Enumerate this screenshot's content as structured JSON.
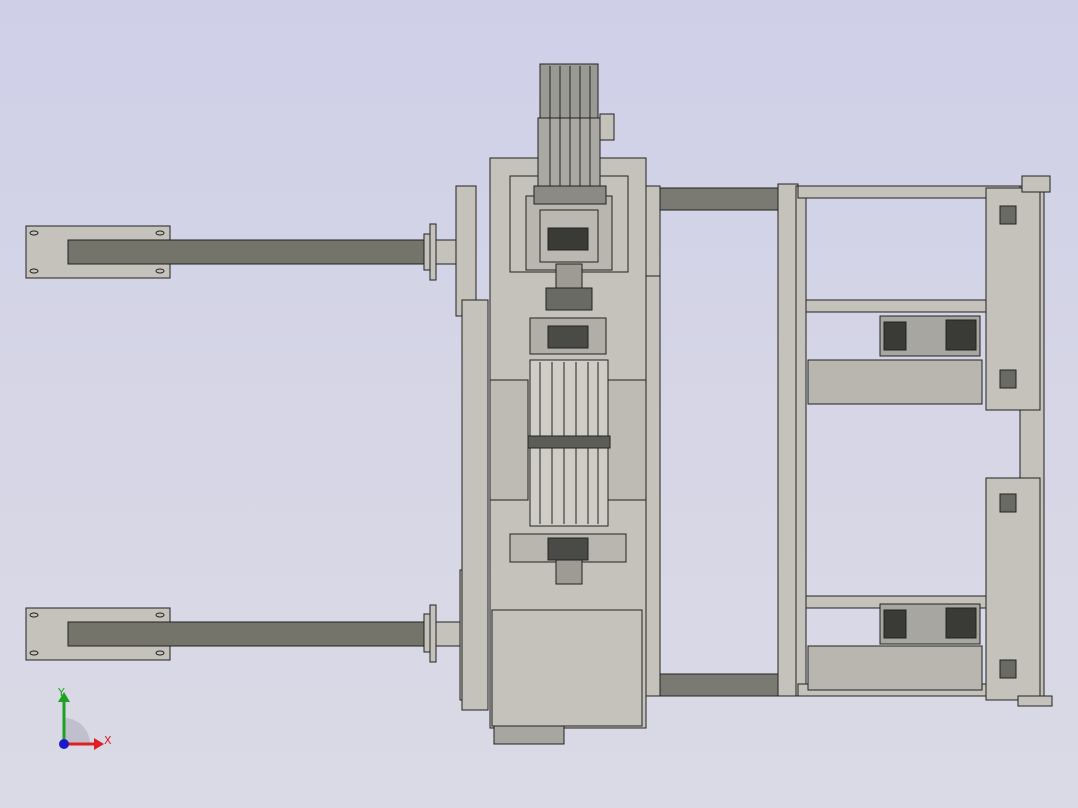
{
  "viewport": {
    "background_top": "#cfd0e8",
    "background_bottom": "#dadae6"
  },
  "model": {
    "part_fill": "#c4c2ba",
    "part_dark": "#74746a",
    "edge_color": "#222222",
    "rail_fill": "#7a7a72"
  },
  "triad": {
    "y_label": "Y",
    "x_label": "X",
    "y_color": "#1fa01f",
    "x_color": "#e02020",
    "z_color": "#1a1acc"
  }
}
